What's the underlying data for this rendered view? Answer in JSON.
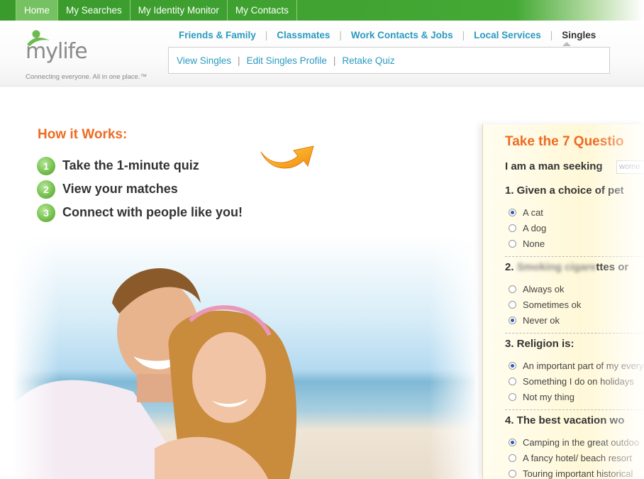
{
  "topnav": {
    "tabs": [
      {
        "label": "Home"
      },
      {
        "label": "My Searches"
      },
      {
        "label": "My Identity Monitor"
      },
      {
        "label": "My Contacts"
      }
    ]
  },
  "header": {
    "logo_text": "mylife",
    "tagline": "Connecting everyone. All in one place.™",
    "categories": [
      {
        "label": "Friends & Family"
      },
      {
        "label": "Classmates"
      },
      {
        "label": "Work Contacts & Jobs"
      },
      {
        "label": "Local Services"
      },
      {
        "label": "Singles"
      }
    ],
    "subnav": [
      {
        "label": "View Singles"
      },
      {
        "label": "Edit Singles Profile"
      },
      {
        "label": "Retake Quiz"
      }
    ]
  },
  "how": {
    "title": "How it Works:",
    "steps": [
      {
        "num": "1",
        "text": "Take the 1-minute quiz"
      },
      {
        "num": "2",
        "text": "View your matches"
      },
      {
        "num": "3",
        "text": "Connect with people like you!"
      }
    ]
  },
  "quiz": {
    "title": "Take the 7 Questio",
    "seeking_label": "I am a man seeking",
    "seeking_value": "wome",
    "questions": [
      {
        "label": "1. Given a choice of pet",
        "options": [
          {
            "label": "A cat",
            "checked": true
          },
          {
            "label": "A dog",
            "checked": false
          },
          {
            "label": "None",
            "checked": false
          }
        ]
      },
      {
        "label_prefix": "2.",
        "label_blur": "Smoking cigare",
        "label_suffix": "ttes or",
        "options": [
          {
            "label": "Always ok",
            "checked": false
          },
          {
            "label": "Sometimes ok",
            "checked": false
          },
          {
            "label": "Never ok",
            "checked": true
          }
        ]
      },
      {
        "label": "3. Religion is:",
        "options": [
          {
            "label": "An important part of my every",
            "checked": true
          },
          {
            "label": "Something I do on holidays",
            "checked": false
          },
          {
            "label": "Not my thing",
            "checked": false
          }
        ]
      },
      {
        "label": "4. The best vacation wo",
        "options": [
          {
            "label": "Camping in the great outdoo",
            "checked": true
          },
          {
            "label": "A fancy hotel/ beach resort",
            "checked": false
          },
          {
            "label": "Touring important historical",
            "checked": false
          }
        ]
      }
    ]
  },
  "colors": {
    "nav_green": "#44a935",
    "link_blue": "#2a9ac0",
    "accent_orange": "#ee6a22",
    "quiz_bg": "#fff8d8"
  },
  "icons": [
    "mylife-logo-icon",
    "curved-arrow-icon",
    "radio-icon"
  ]
}
